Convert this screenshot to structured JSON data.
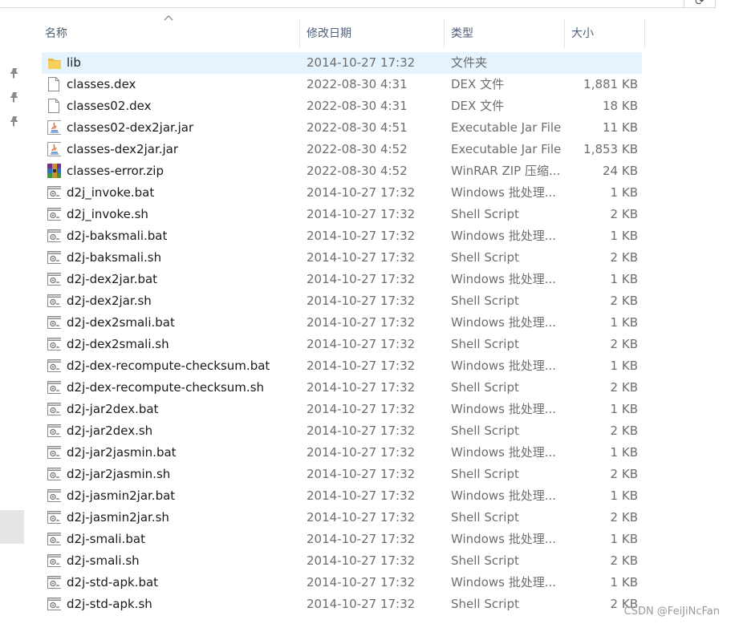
{
  "address": {
    "text": "",
    "refresh_glyph": "⟳"
  },
  "columns": {
    "name": "名称",
    "date": "修改日期",
    "type": "类型",
    "size": "大小"
  },
  "pins": [
    "📌",
    "📌",
    "📌"
  ],
  "rows": [
    {
      "name": "lib",
      "date": "2014-10-27 17:32",
      "type": "文件夹",
      "size": "",
      "icon": "folder"
    },
    {
      "name": "classes.dex",
      "date": "2022-08-30 4:31",
      "type": "DEX 文件",
      "size": "1,881 KB",
      "icon": "file"
    },
    {
      "name": "classes02.dex",
      "date": "2022-08-30 4:31",
      "type": "DEX 文件",
      "size": "18 KB",
      "icon": "file"
    },
    {
      "name": "classes02-dex2jar.jar",
      "date": "2022-08-30 4:51",
      "type": "Executable Jar File",
      "size": "11 KB",
      "icon": "jar"
    },
    {
      "name": "classes-dex2jar.jar",
      "date": "2022-08-30 4:52",
      "type": "Executable Jar File",
      "size": "1,853 KB",
      "icon": "jar"
    },
    {
      "name": "classes-error.zip",
      "date": "2022-08-30 4:52",
      "type": "WinRAR ZIP 压缩...",
      "size": "24 KB",
      "icon": "zip"
    },
    {
      "name": "d2j_invoke.bat",
      "date": "2014-10-27 17:32",
      "type": "Windows 批处理...",
      "size": "1 KB",
      "icon": "script"
    },
    {
      "name": "d2j_invoke.sh",
      "date": "2014-10-27 17:32",
      "type": "Shell Script",
      "size": "2 KB",
      "icon": "script"
    },
    {
      "name": "d2j-baksmali.bat",
      "date": "2014-10-27 17:32",
      "type": "Windows 批处理...",
      "size": "1 KB",
      "icon": "script"
    },
    {
      "name": "d2j-baksmali.sh",
      "date": "2014-10-27 17:32",
      "type": "Shell Script",
      "size": "2 KB",
      "icon": "script"
    },
    {
      "name": "d2j-dex2jar.bat",
      "date": "2014-10-27 17:32",
      "type": "Windows 批处理...",
      "size": "1 KB",
      "icon": "script"
    },
    {
      "name": "d2j-dex2jar.sh",
      "date": "2014-10-27 17:32",
      "type": "Shell Script",
      "size": "2 KB",
      "icon": "script"
    },
    {
      "name": "d2j-dex2smali.bat",
      "date": "2014-10-27 17:32",
      "type": "Windows 批处理...",
      "size": "1 KB",
      "icon": "script"
    },
    {
      "name": "d2j-dex2smali.sh",
      "date": "2014-10-27 17:32",
      "type": "Shell Script",
      "size": "2 KB",
      "icon": "script"
    },
    {
      "name": "d2j-dex-recompute-checksum.bat",
      "date": "2014-10-27 17:32",
      "type": "Windows 批处理...",
      "size": "1 KB",
      "icon": "script"
    },
    {
      "name": "d2j-dex-recompute-checksum.sh",
      "date": "2014-10-27 17:32",
      "type": "Shell Script",
      "size": "2 KB",
      "icon": "script"
    },
    {
      "name": "d2j-jar2dex.bat",
      "date": "2014-10-27 17:32",
      "type": "Windows 批处理...",
      "size": "1 KB",
      "icon": "script"
    },
    {
      "name": "d2j-jar2dex.sh",
      "date": "2014-10-27 17:32",
      "type": "Shell Script",
      "size": "2 KB",
      "icon": "script"
    },
    {
      "name": "d2j-jar2jasmin.bat",
      "date": "2014-10-27 17:32",
      "type": "Windows 批处理...",
      "size": "1 KB",
      "icon": "script"
    },
    {
      "name": "d2j-jar2jasmin.sh",
      "date": "2014-10-27 17:32",
      "type": "Shell Script",
      "size": "2 KB",
      "icon": "script"
    },
    {
      "name": "d2j-jasmin2jar.bat",
      "date": "2014-10-27 17:32",
      "type": "Windows 批处理...",
      "size": "1 KB",
      "icon": "script"
    },
    {
      "name": "d2j-jasmin2jar.sh",
      "date": "2014-10-27 17:32",
      "type": "Shell Script",
      "size": "2 KB",
      "icon": "script"
    },
    {
      "name": "d2j-smali.bat",
      "date": "2014-10-27 17:32",
      "type": "Windows 批处理...",
      "size": "1 KB",
      "icon": "script"
    },
    {
      "name": "d2j-smali.sh",
      "date": "2014-10-27 17:32",
      "type": "Shell Script",
      "size": "2 KB",
      "icon": "script"
    },
    {
      "name": "d2j-std-apk.bat",
      "date": "2014-10-27 17:32",
      "type": "Windows 批处理...",
      "size": "1 KB",
      "icon": "script"
    },
    {
      "name": "d2j-std-apk.sh",
      "date": "2014-10-27 17:32",
      "type": "Shell Script",
      "size": "2 KB",
      "icon": "script"
    }
  ],
  "selected_row": 0,
  "watermark": "CSDN @FeiJiNcFan",
  "colors": {
    "selection": "#e5f3ff",
    "header_text": "#4c607a",
    "secondary_text": "#6d6d6d",
    "folder": "#f0c24a"
  }
}
